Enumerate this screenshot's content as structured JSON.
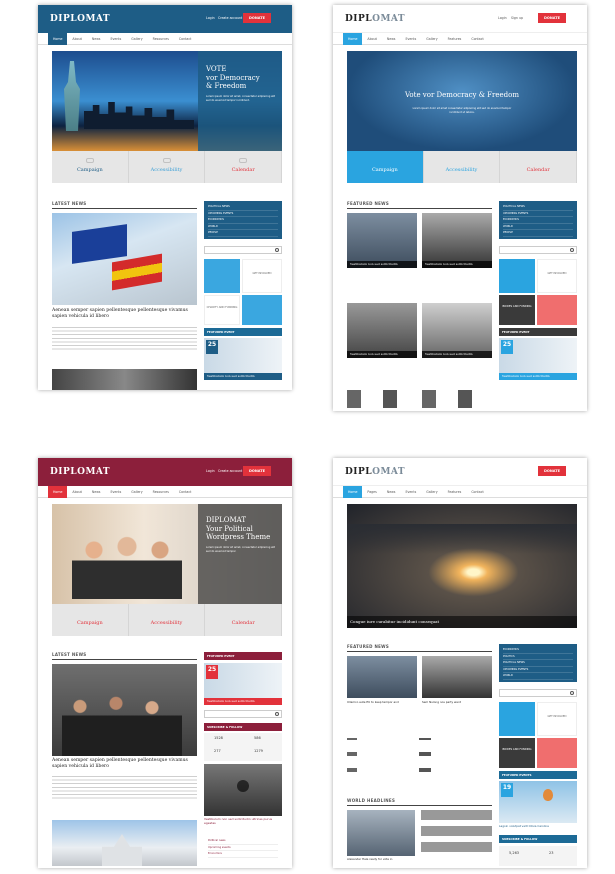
{
  "screenshots": [
    {
      "brand": "DIPLOMAT",
      "header_links": [
        "Login",
        "Create account"
      ],
      "donate_label": "DONATE",
      "nav": [
        "Home",
        "About",
        "News",
        "Events",
        "Gallery",
        "Resources",
        "Contact"
      ],
      "hero": {
        "line1": "VOTE",
        "line2": "vor Democracy",
        "line3": "& Freedom",
        "desc": "Lorem ipsum dolor sit amet, consectetur adipiscing elit sed do eiusmod tempor incididunt."
      },
      "features": [
        "Campaign",
        "Accessibility",
        "Calendar"
      ],
      "section": "LATEST NEWS",
      "caption": "Aenean semper sapien pellentesque pellentesque vivamus sapien vehicula id libero",
      "sidebar": [
        "POLITICAL NEWS",
        "UPCOMING EVENTS",
        "ECONOMICS",
        "WORLD",
        "PEOPLE"
      ],
      "tiles": [
        "GET INVOLVED",
        "CHARITY AND FUNDING"
      ],
      "featured_event": "FEATURED EVENT",
      "event_day": "25",
      "event_caption": "Vestibulum non sed sollicitudin"
    },
    {
      "brand_a": "DIPL",
      "brand_b": "OMAT",
      "header_links": [
        "Login",
        "Sign up"
      ],
      "donate_label": "DONATE",
      "nav": [
        "Home",
        "About",
        "News",
        "Events",
        "Gallery",
        "Features",
        "Contact"
      ],
      "hero": {
        "title": "Vote vor Democracy & Freedom",
        "desc": "Lorem ipsum dolor sit amet consectetur adipiscing elit sed do eiusmod tempor incididunt ut labore."
      },
      "features": [
        "Campaign",
        "Accessibility",
        "Calendar"
      ],
      "section": "FEATURED NEWS",
      "captions": [
        "Vestibulum non sed sollicitudin",
        "Vestibulum non sed sollicitudin",
        "Vestibulum non sed sollicitudin",
        "Vestibulum non sed sollicitudin"
      ],
      "sidebar": [
        "POLITICAL NEWS",
        "UPCOMING EVENTS",
        "ECONOMICS",
        "WORLD",
        "PEOPLE"
      ],
      "tiles": [
        "GET INVOLVED",
        "BRIDES AND FUNDING"
      ],
      "featured_event": "FEATURED EVENT",
      "event_day": "25",
      "event_caption": "Vestibulum non sed sollicitudin"
    },
    {
      "brand": "DIPLOMAT",
      "header_links": [
        "Login",
        "Create account"
      ],
      "donate_label": "DONATE",
      "nav": [
        "Home",
        "About",
        "News",
        "Events",
        "Gallery",
        "Resources",
        "Contact"
      ],
      "hero": {
        "line1": "DIPLOMAT",
        "line2": "Your Political",
        "line3": "Wordpress Theme",
        "desc": "Lorem ipsum dolor sit amet, consectetur adipiscing elit sed do eiusmod tempor."
      },
      "features": [
        "Campaign",
        "Accessibility",
        "Calendar"
      ],
      "section": "LATEST NEWS",
      "caption": "Aenean semper sapien pellentesque pellentesque vivamus sapien vehicula id libero",
      "featured_event": "FEATURED EVENT",
      "event_day": "25",
      "event_caption": "Vestibulum non sed sollicitudin",
      "subscribe": "SUBSCRIBE & FOLLOW",
      "counts": [
        "1528",
        "586",
        "277",
        "1279"
      ],
      "video_caption": "Vestibulum non sed sollicitudin ultrices purus egestas",
      "menu": [
        "Political news",
        "Upcoming events",
        "Economics"
      ]
    },
    {
      "brand_a": "DIPL",
      "brand_b": "OMAT",
      "donate_label": "DONATE",
      "nav": [
        "Home",
        "Pages",
        "News",
        "Events",
        "Gallery",
        "Features",
        "Contact"
      ],
      "hero_caption": "Congue iure curabitur incididunt consequat",
      "section1": "FEATURED NEWS",
      "captions": [
        "Ullamco aute EU to keep tempor and",
        "Sem Nulong nos party went"
      ],
      "section2": "WORLD HEADLINES",
      "headline": "Alexander Hale ready for vote in",
      "sidebar": [
        "ECONOMICS",
        "POLITICS",
        "POLITICAL NEWS",
        "UPCOMING EVENTS",
        "WORLD"
      ],
      "tiles": [
        "GET INVOLVED",
        "BRIDES AND FUNDING"
      ],
      "featured_events": "FEATURED EVENTS",
      "event_day": "19",
      "event_caption": "Lagoin volutpat velit Olivia Carolina",
      "subscribe": "SUBSCRIBE & FOLLOW",
      "counts": [
        "5,263",
        "23"
      ]
    }
  ]
}
